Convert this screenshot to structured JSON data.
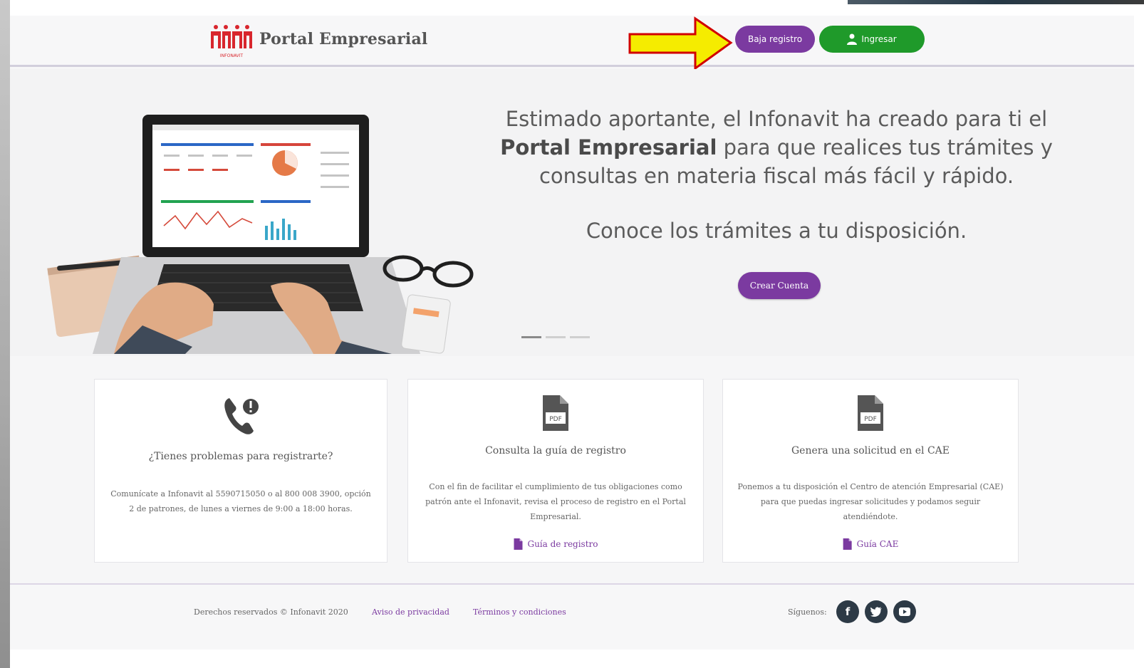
{
  "header": {
    "brand": "Portal Empresarial",
    "logo_caption": "INFONAVIT",
    "register_label": "Baja registro",
    "login_label": "Ingresar"
  },
  "hero": {
    "line1": "Estimado aportante, el Infonavit ha creado para ti el",
    "line2_bold": "Portal Empresarial",
    "line2_rest": " para que realices tus trámites y",
    "line3": "consultas en materia fiscal más fácil y rápido.",
    "subheading": "Conoce los trámites a tu disposición.",
    "cta_label": "Crear Cuenta"
  },
  "cards": [
    {
      "title": "¿Tienes problemas para registrarte?",
      "body": "Comunícate a Infonavit al 5590715050 o al 800 008 3900, opción 2 de patrones, de lunes a viernes de 9:00 a 18:00 horas."
    },
    {
      "title": "Consulta la guía de registro",
      "body": "Con el fin de facilitar el cumplimiento de tus obligaciones como patrón ante el Infonavit, revisa el proceso de registro en el Portal Empresarial.",
      "link": "Guía de registro"
    },
    {
      "title": "Genera una solicitud en el CAE",
      "body": "Ponemos a tu disposición el Centro de atención Empresarial (CAE) para que puedas ingresar solicitudes y podamos seguir atendiéndote.",
      "link": "Guía CAE"
    }
  ],
  "footer": {
    "copyright": "Derechos reservados © Infonavit 2020",
    "privacy": "Aviso de privacidad",
    "terms": "Términos y condiciones",
    "follow": "Síguenos:"
  },
  "colors": {
    "accent_purple": "#7b3aa0",
    "login_green": "#1f9a2a",
    "arrow_yellow": "#f5ec00",
    "arrow_red": "#d10000",
    "logo_red": "#d8262d"
  },
  "icons": [
    "infonavit-logo",
    "user-icon",
    "phone-icon",
    "pdf-icon",
    "document-icon",
    "facebook-icon",
    "twitter-icon",
    "youtube-icon"
  ]
}
